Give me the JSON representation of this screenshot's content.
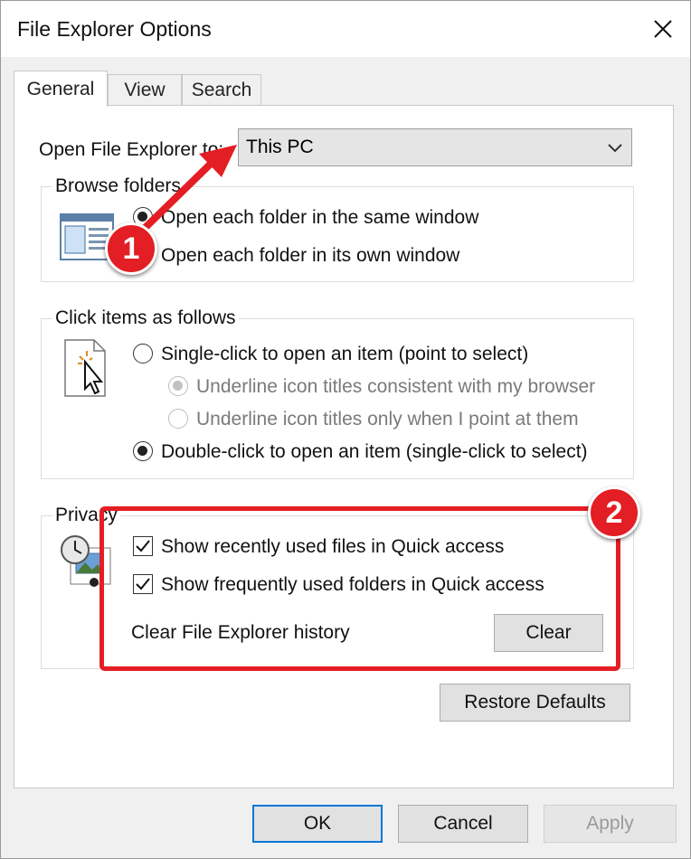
{
  "window": {
    "title": "File Explorer Options"
  },
  "tabs": [
    {
      "label": "General",
      "active": true
    },
    {
      "label": "View",
      "active": false
    },
    {
      "label": "Search",
      "active": false
    }
  ],
  "open_to": {
    "label": "Open File Explorer to:",
    "value": "This PC"
  },
  "browse_folders": {
    "title": "Browse folders",
    "options": [
      {
        "label": "Open each folder in the same window",
        "selected": true
      },
      {
        "label": "Open each folder in its own window",
        "selected": false
      }
    ]
  },
  "click_items": {
    "title": "Click items as follows",
    "single_click": {
      "label": "Single-click to open an item (point to select)",
      "selected": false
    },
    "underline_browser": {
      "label": "Underline icon titles consistent with my browser",
      "selected": true,
      "disabled": true
    },
    "underline_point": {
      "label": "Underline icon titles only when I point at them",
      "selected": false,
      "disabled": true
    },
    "double_click": {
      "label": "Double-click to open an item (single-click to select)",
      "selected": true
    }
  },
  "privacy": {
    "title": "Privacy",
    "recent_files": {
      "label": "Show recently used files in Quick access",
      "checked": true
    },
    "frequent_folders": {
      "label": "Show frequently used folders in Quick access",
      "checked": true
    },
    "clear_history_label": "Clear File Explorer history",
    "clear_button": "Clear"
  },
  "restore_defaults": "Restore Defaults",
  "footer": {
    "ok": "OK",
    "cancel": "Cancel",
    "apply": "Apply"
  },
  "annotations": {
    "badge1": "1",
    "badge2": "2",
    "color": "#e31e24"
  },
  "colors": {
    "accent": "#0078d7",
    "dialog_bg": "#f0f0f0"
  }
}
